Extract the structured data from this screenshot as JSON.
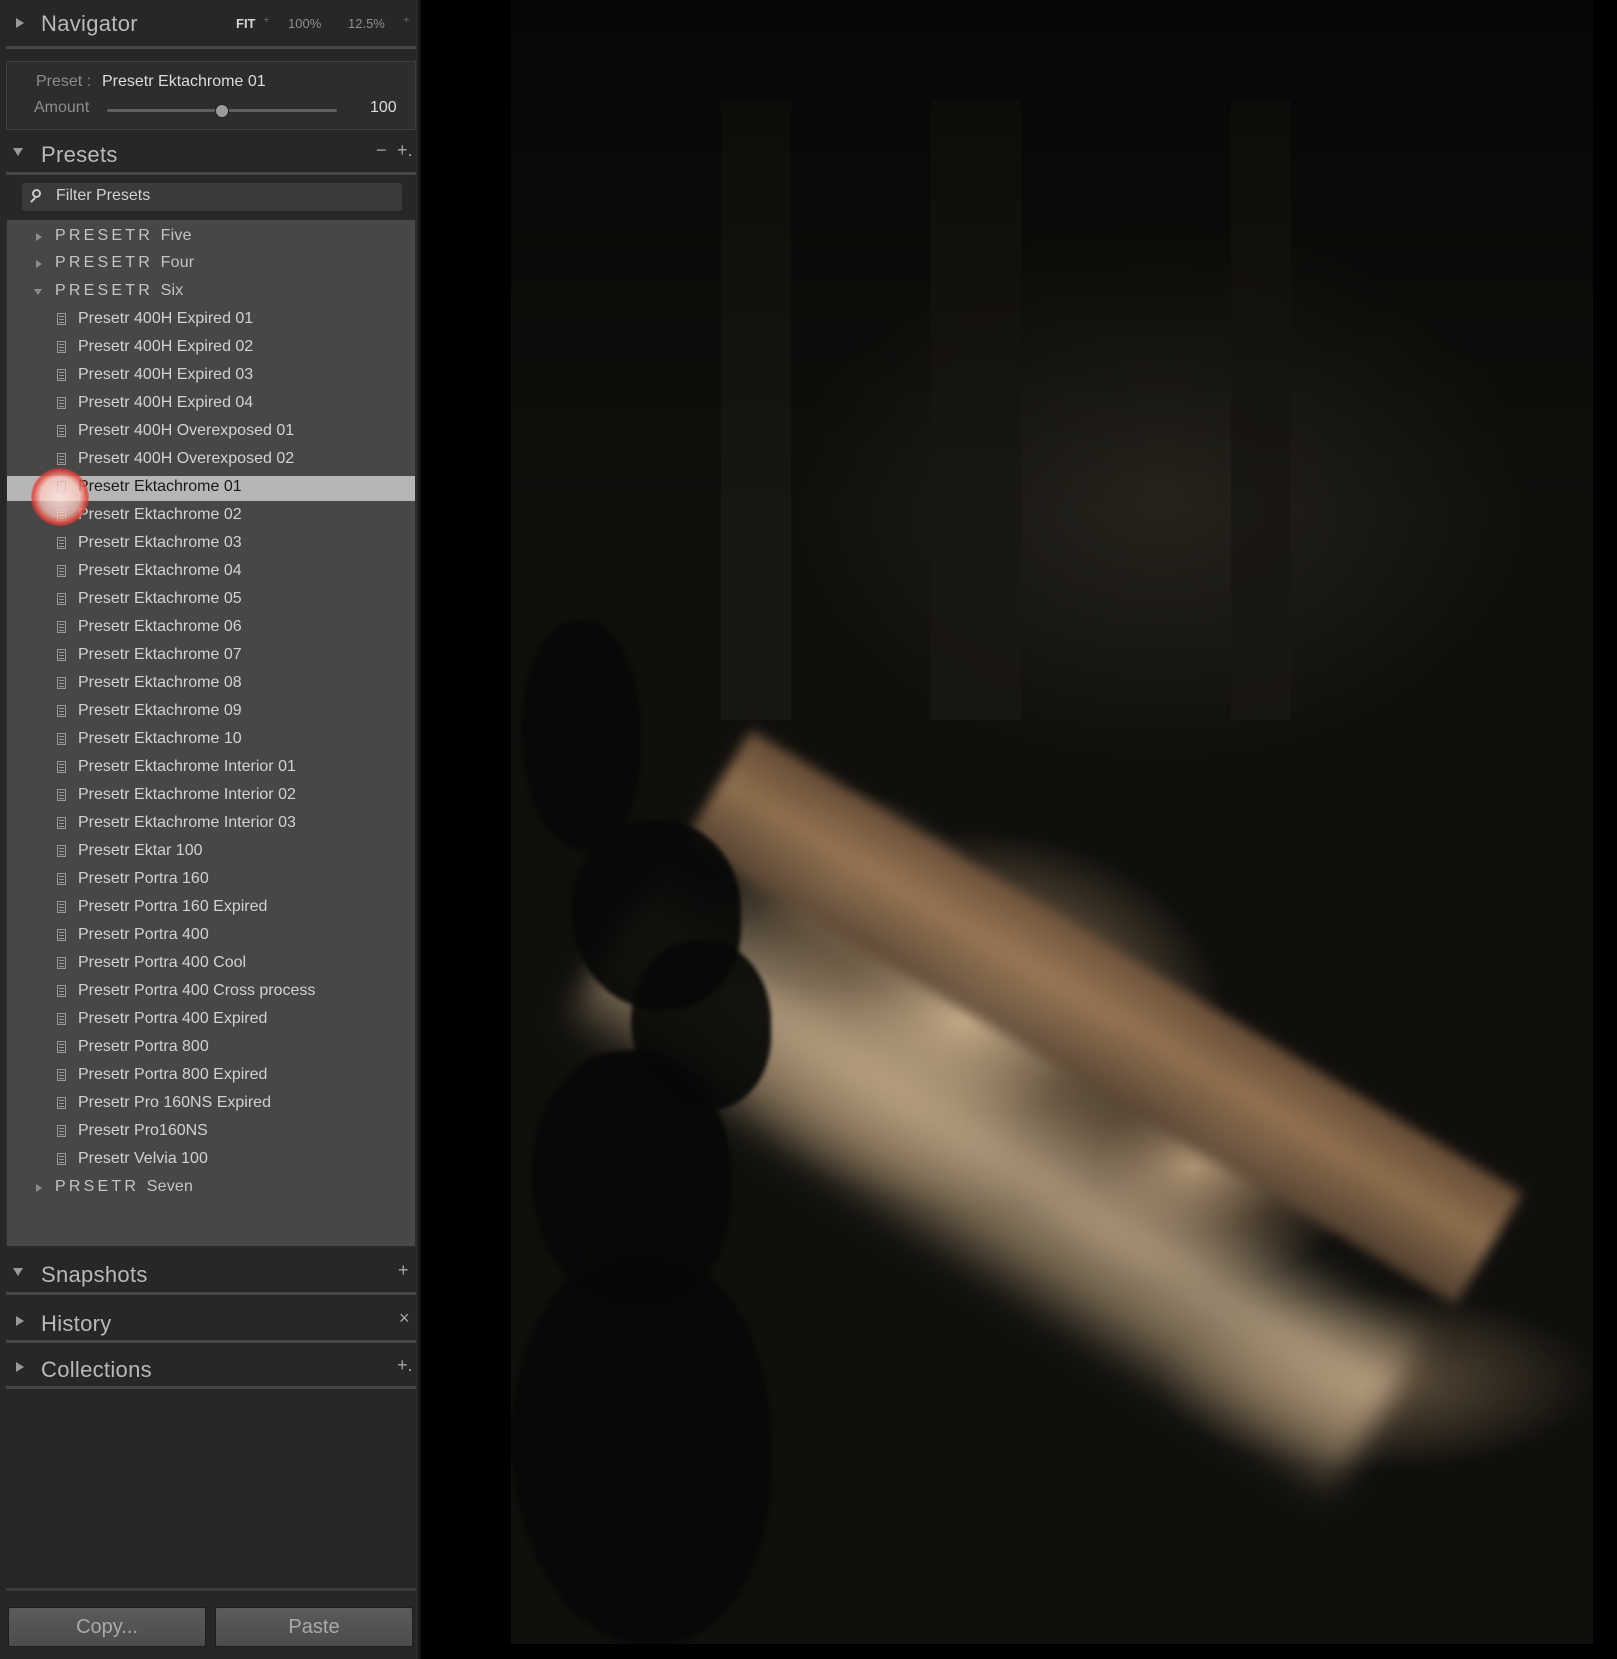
{
  "navigator": {
    "title": "Navigator",
    "zoom_options": [
      {
        "label": "FIT",
        "active": true
      },
      {
        "label": "100%",
        "active": false
      },
      {
        "label": "12.5%",
        "active": false
      }
    ],
    "spinner_glyph": "÷"
  },
  "preset_amount": {
    "preset_label": "Preset :",
    "preset_value": "Presetr Ektachrome 01",
    "amount_label": "Amount",
    "amount_value": "100",
    "slider_fraction": 0.5
  },
  "presets": {
    "title": "Presets",
    "remove_label": "−",
    "add_label": "+.",
    "filter_placeholder": "Filter Presets",
    "folders": [
      {
        "name_spaced": "PRESETR",
        "name_tail": "Five",
        "expanded": false
      },
      {
        "name_spaced": "PRESETR",
        "name_tail": "Four",
        "expanded": false
      },
      {
        "name_spaced": "PRESETR",
        "name_tail": "Six",
        "expanded": true
      },
      {
        "name_spaced": "PRSETR",
        "name_tail": "Seven",
        "expanded": false
      }
    ],
    "items": [
      "Presetr 400H Expired 01",
      "Presetr 400H Expired 02",
      "Presetr 400H Expired 03",
      "Presetr 400H Expired 04",
      "Presetr 400H Overexposed 01",
      "Presetr 400H Overexposed 02",
      "Presetr Ektachrome 01",
      "Presetr Ektachrome 02",
      "Presetr Ektachrome 03",
      "Presetr Ektachrome 04",
      "Presetr Ektachrome 05",
      "Presetr Ektachrome 06",
      "Presetr Ektachrome 07",
      "Presetr Ektachrome 08",
      "Presetr Ektachrome 09",
      "Presetr Ektachrome 10",
      "Presetr Ektachrome Interior 01",
      "Presetr Ektachrome Interior 02",
      "Presetr Ektachrome Interior 03",
      "Presetr Ektar 100",
      "Presetr Portra 160",
      "Presetr Portra 160 Expired",
      "Presetr Portra 400",
      "Presetr Portra 400 Cool",
      "Presetr Portra 400 Cross process",
      "Presetr Portra 400 Expired",
      "Presetr Portra 800",
      "Presetr Portra 800 Expired",
      "Presetr Pro 160NS Expired",
      "Presetr Pro160NS",
      "Presetr Velvia 100"
    ],
    "selected_item": "Presetr Ektachrome 01"
  },
  "snapshots": {
    "title": "Snapshots",
    "action": "+"
  },
  "history": {
    "title": "History",
    "action": "×"
  },
  "collections": {
    "title": "Collections",
    "action": "+."
  },
  "buttons": {
    "copy": "Copy...",
    "paste": "Paste"
  },
  "icons": {
    "preset_item": "preset-document-icon",
    "filter": "search-icon",
    "panel_toggle": "disclosure-triangle-icon"
  },
  "colors": {
    "panel_bg": "#272727",
    "list_bg": "#474747",
    "selection": "#b6b6b6",
    "click_indicator": "#e63c32"
  }
}
